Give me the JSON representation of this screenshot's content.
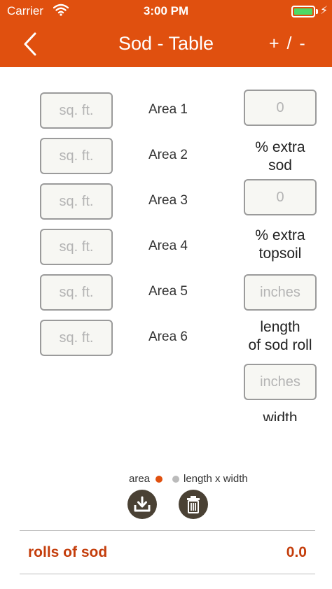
{
  "status_bar": {
    "carrier": "Carrier",
    "time": "3:00 PM"
  },
  "nav": {
    "title": "Sod - Table",
    "action_label": "+ / -"
  },
  "areas": [
    {
      "label": "Area 1",
      "placeholder": "sq. ft."
    },
    {
      "label": "Area 2",
      "placeholder": "sq. ft."
    },
    {
      "label": "Area 3",
      "placeholder": "sq. ft."
    },
    {
      "label": "Area 4",
      "placeholder": "sq. ft."
    },
    {
      "label": "Area 5",
      "placeholder": "sq. ft."
    },
    {
      "label": "Area 6",
      "placeholder": "sq. ft."
    }
  ],
  "settings": {
    "extra_sod": {
      "placeholder": "0",
      "label_line1": "% extra",
      "label_line2": "sod"
    },
    "extra_topsoil": {
      "placeholder": "0",
      "label_line1": "% extra",
      "label_line2": "topsoil"
    },
    "roll_length": {
      "placeholder": "inches",
      "label_line1": "length",
      "label_line2": "of sod roll"
    },
    "roll_width": {
      "placeholder": "inches",
      "label_line1": "width"
    }
  },
  "mode": {
    "option_area": "area",
    "option_length_width": "length x width",
    "selected": "area"
  },
  "buttons": {
    "save_icon": "download-tray-icon",
    "clear_icon": "trash-icon"
  },
  "result": {
    "label": "rolls of sod",
    "value": "0.0"
  },
  "colors": {
    "header": "#e0500f",
    "accent_text": "#c43d0b",
    "button_bg": "#4a4134",
    "radio_selected": "#e0500f",
    "radio_unselected": "#bbbbbb",
    "battery": "#4cd964"
  }
}
